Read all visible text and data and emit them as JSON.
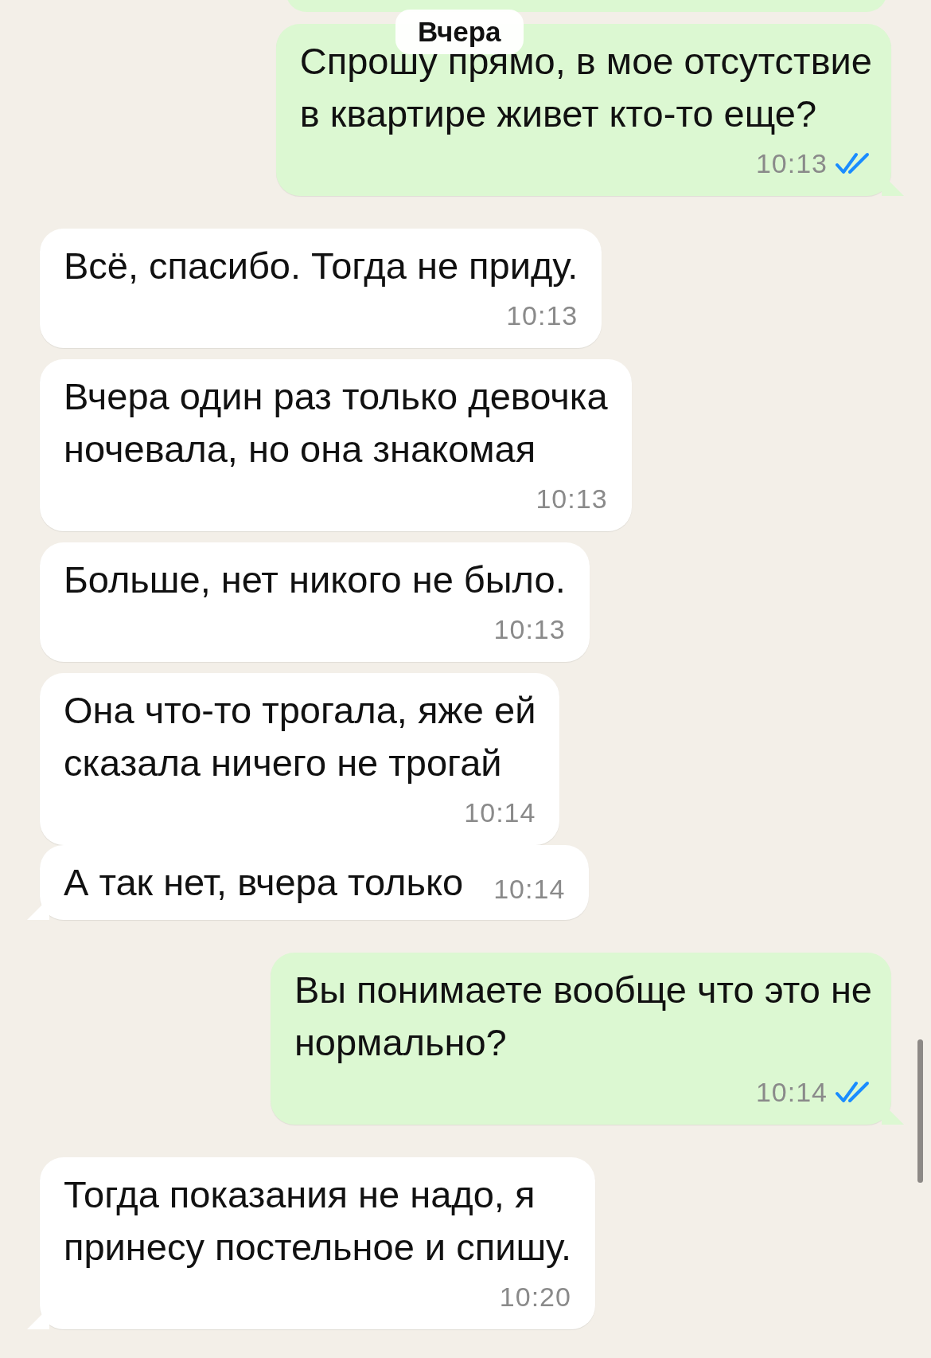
{
  "date_chip": "Вчера",
  "messages": [
    {
      "outgoing": true,
      "text": "Спрошу прямо, в мое отсутствие\nв квартире живет кто-то еще?",
      "time": "10:13",
      "read": true,
      "tail": true,
      "kind": "block"
    },
    {
      "outgoing": false,
      "text": "Всё, спасибо. Тогда не приду.",
      "time": "10:13",
      "tail": false,
      "kind": "block"
    },
    {
      "outgoing": false,
      "text": "Вчера один раз только девочка\nночевала, но она знакомая",
      "time": "10:13",
      "tail": false,
      "kind": "block"
    },
    {
      "outgoing": false,
      "text": "Больше, нет никого не было.",
      "time": "10:13",
      "tail": false,
      "kind": "block"
    },
    {
      "outgoing": false,
      "text": "Она что-то трогала, яже ей\nсказала ничего не трогай",
      "time": "10:14",
      "tail": false,
      "kind": "block"
    },
    {
      "outgoing": false,
      "text": "А так нет, вчера только",
      "time": "10:14",
      "tail": true,
      "kind": "inline"
    },
    {
      "outgoing": true,
      "text": "Вы понимаете вообще что это не\nнормально?",
      "time": "10:14",
      "read": true,
      "tail": true,
      "kind": "block"
    },
    {
      "outgoing": false,
      "text": "Тогда показания не надо, я\nпринесу постельное и спишу.",
      "time": "10:20",
      "tail": true,
      "kind": "block"
    }
  ]
}
